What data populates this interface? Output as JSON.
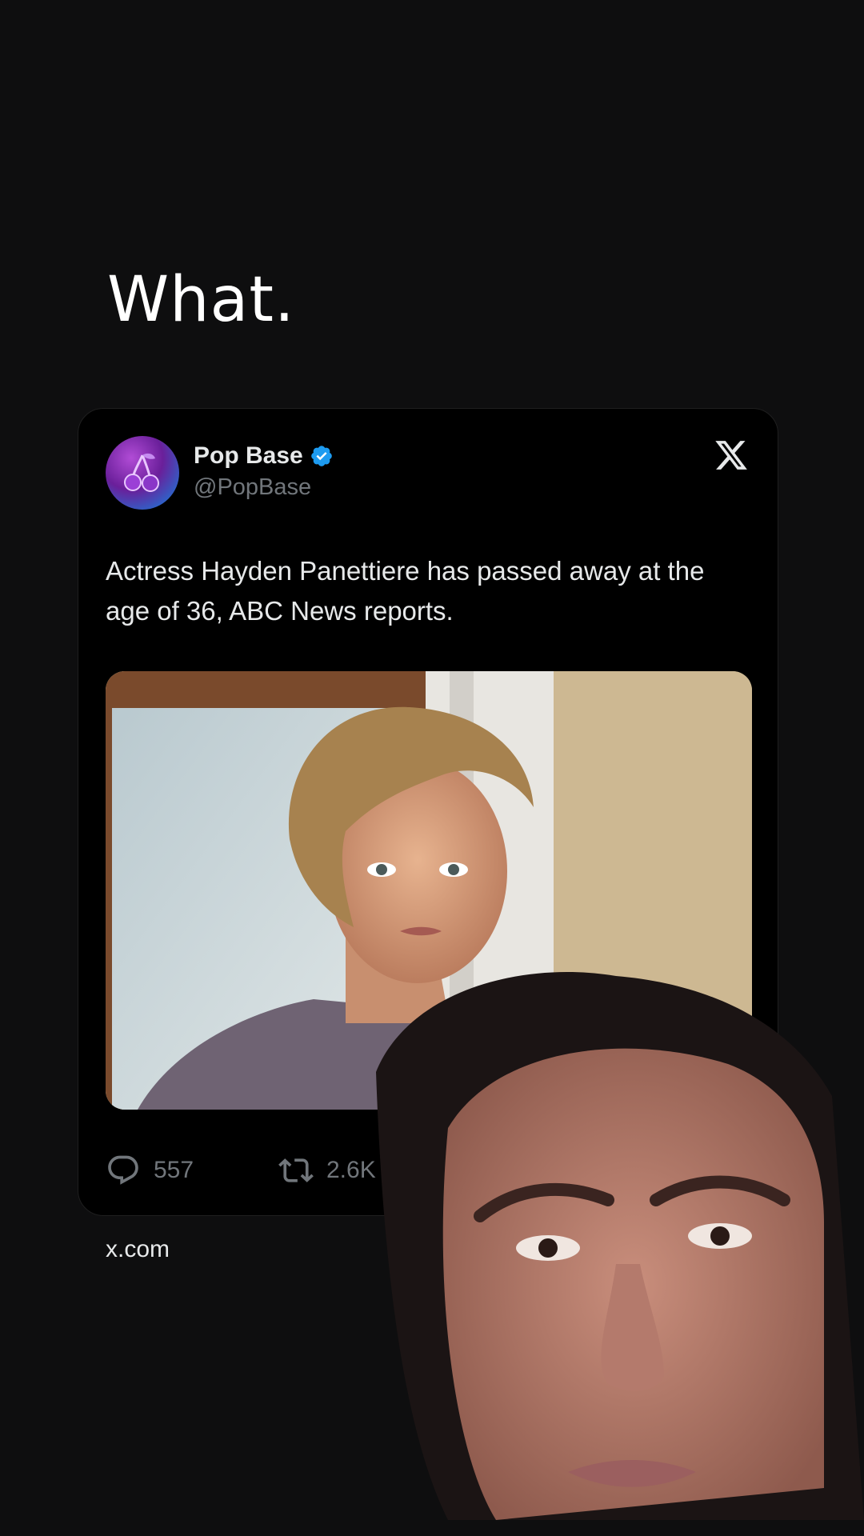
{
  "caption": "What.",
  "tweet": {
    "author_name": "Pop Base",
    "author_handle": "@PopBase",
    "text": "Actress Hayden Panettiere has passed away at the age of 36, ABC News reports.",
    "replies": "557",
    "reposts": "2.6K"
  },
  "source": "x.com",
  "icons": {
    "brand": "x-logo-icon",
    "verified": "verified-badge-icon",
    "reply": "reply-icon",
    "repost": "repost-icon"
  },
  "colors": {
    "background": "#0e0e0f",
    "card": "#000000",
    "verified": "#1d9bf0",
    "muted_text": "#71767b",
    "primary_text": "#e7e9ea"
  }
}
